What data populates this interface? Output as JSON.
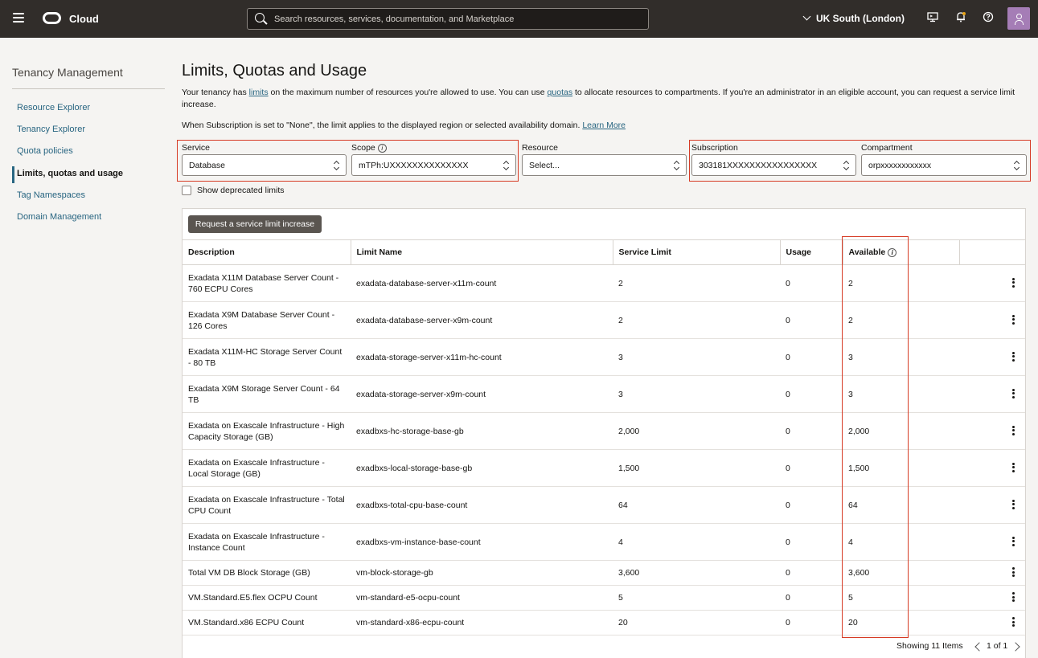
{
  "topbar": {
    "brand": "Cloud",
    "search_placeholder": "Search resources, services, documentation, and Marketplace",
    "region": "UK South (London)"
  },
  "sidebar": {
    "title": "Tenancy Management",
    "items": [
      {
        "label": "Resource Explorer"
      },
      {
        "label": "Tenancy Explorer"
      },
      {
        "label": "Quota policies"
      },
      {
        "label": "Limits, quotas and usage"
      },
      {
        "label": "Tag Namespaces"
      },
      {
        "label": "Domain Management"
      }
    ]
  },
  "main": {
    "title": "Limits, Quotas and Usage",
    "desc_a": "Your tenancy has ",
    "desc_link1": "limits",
    "desc_b": " on the maximum number of resources you're allowed to use. You can use ",
    "desc_link2": "quotas",
    "desc_c": " to allocate resources to compartments. If you're an administrator in an eligible account, you can request a service limit increase.",
    "note": "When Subscription is set to \"None\", the limit applies to the displayed region or selected availability domain. ",
    "note_link": "Learn More"
  },
  "filters": {
    "service_label": "Service",
    "service_value": "Database",
    "scope_label": "Scope",
    "scope_value": "mTPh:UXXXXXXXXXXXXXX",
    "resource_label": "Resource",
    "resource_value": "Select...",
    "subscription_label": "Subscription",
    "subscription_value": "303181XXXXXXXXXXXXXXXX",
    "compartment_label": "Compartment",
    "compartment_value": "orpxxxxxxxxxxxx",
    "deprecated_label": "Show deprecated limits"
  },
  "table": {
    "request_button": "Request a service limit increase",
    "headers": [
      "Description",
      "Limit Name",
      "Service Limit",
      "Usage",
      "Available"
    ],
    "rows": [
      {
        "desc": "Exadata X11M Database Server Count - 760 ECPU Cores",
        "name": "exadata-database-server-x11m-count",
        "limit": "2",
        "usage": "0",
        "avail": "2"
      },
      {
        "desc": "Exadata X9M Database Server Count - 126 Cores",
        "name": "exadata-database-server-x9m-count",
        "limit": "2",
        "usage": "0",
        "avail": "2"
      },
      {
        "desc": "Exadata X11M-HC Storage Server Count - 80 TB",
        "name": "exadata-storage-server-x11m-hc-count",
        "limit": "3",
        "usage": "0",
        "avail": "3"
      },
      {
        "desc": "Exadata X9M Storage Server Count - 64 TB",
        "name": "exadata-storage-server-x9m-count",
        "limit": "3",
        "usage": "0",
        "avail": "3"
      },
      {
        "desc": "Exadata on Exascale Infrastructure - High Capacity Storage (GB)",
        "name": "exadbxs-hc-storage-base-gb",
        "limit": "2,000",
        "usage": "0",
        "avail": "2,000"
      },
      {
        "desc": "Exadata on Exascale Infrastructure - Local Storage (GB)",
        "name": "exadbxs-local-storage-base-gb",
        "limit": "1,500",
        "usage": "0",
        "avail": "1,500"
      },
      {
        "desc": "Exadata on Exascale Infrastructure - Total CPU Count",
        "name": "exadbxs-total-cpu-base-count",
        "limit": "64",
        "usage": "0",
        "avail": "64"
      },
      {
        "desc": "Exadata on Exascale Infrastructure - Instance Count",
        "name": "exadbxs-vm-instance-base-count",
        "limit": "4",
        "usage": "0",
        "avail": "4"
      },
      {
        "desc": "Total VM DB Block Storage (GB)",
        "name": "vm-block-storage-gb",
        "limit": "3,600",
        "usage": "0",
        "avail": "3,600"
      },
      {
        "desc": "VM.Standard.E5.flex OCPU Count",
        "name": "vm-standard-e5-ocpu-count",
        "limit": "5",
        "usage": "0",
        "avail": "5"
      },
      {
        "desc": "VM.Standard.x86 ECPU Count",
        "name": "vm-standard-x86-ecpu-count",
        "limit": "20",
        "usage": "0",
        "avail": "20"
      }
    ],
    "footer": "Showing 11 Items",
    "page": "1 of 1"
  }
}
